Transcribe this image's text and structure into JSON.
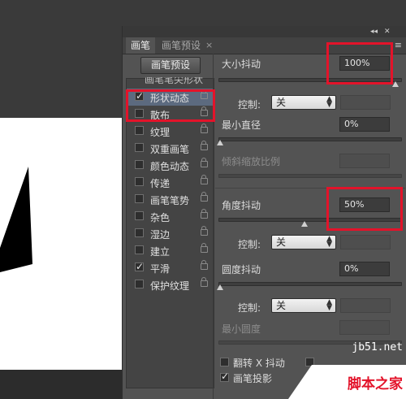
{
  "panel": {
    "collapse_glyph": "◂◂",
    "close_glyph": "✕",
    "menu_glyph": "≡",
    "tabs": [
      {
        "label": "画笔",
        "active": true
      },
      {
        "label": "画笔预设",
        "active": false
      }
    ],
    "tab_close_glyph": "×"
  },
  "left": {
    "preset_button": "画笔预设",
    "list_header_partial": "画笔笔尖形状",
    "items": [
      {
        "label": "形状动态",
        "checked": true,
        "selected": true
      },
      {
        "label": "散布",
        "checked": false
      },
      {
        "label": "纹理",
        "checked": false
      },
      {
        "label": "双重画笔",
        "checked": false
      },
      {
        "label": "颜色动态",
        "checked": false
      },
      {
        "label": "传递",
        "checked": false
      },
      {
        "label": "画笔笔势",
        "checked": false
      },
      {
        "label": "杂色",
        "checked": false
      },
      {
        "label": "湿边",
        "checked": false
      },
      {
        "label": "建立",
        "checked": false
      },
      {
        "label": "平滑",
        "checked": true
      },
      {
        "label": "保护纹理",
        "checked": false
      }
    ]
  },
  "right": {
    "size_jitter": {
      "label": "大小抖动",
      "value": "100%"
    },
    "control_label": "控制:",
    "control1": {
      "value": "关"
    },
    "min_diameter": {
      "label": "最小直径",
      "value": "0%"
    },
    "tilt_scale": {
      "label": "倾斜缩放比例"
    },
    "angle_jitter": {
      "label": "角度抖动",
      "value": "50%"
    },
    "control2": {
      "value": "关"
    },
    "roundness_jitter": {
      "label": "圆度抖动",
      "value": "0%"
    },
    "control3": {
      "value": "关"
    },
    "min_roundness": {
      "label": "最小圆度"
    },
    "flip_x": {
      "label": "翻转 X 抖动"
    },
    "brush_projection": {
      "label": "画笔投影",
      "checked": true
    }
  },
  "watermark": {
    "url": "jb51.net",
    "text": "脚本之家"
  },
  "colors": {
    "highlight": "#e3132a",
    "panel_bg": "#535353",
    "selected_row": "#5c6a7f"
  }
}
